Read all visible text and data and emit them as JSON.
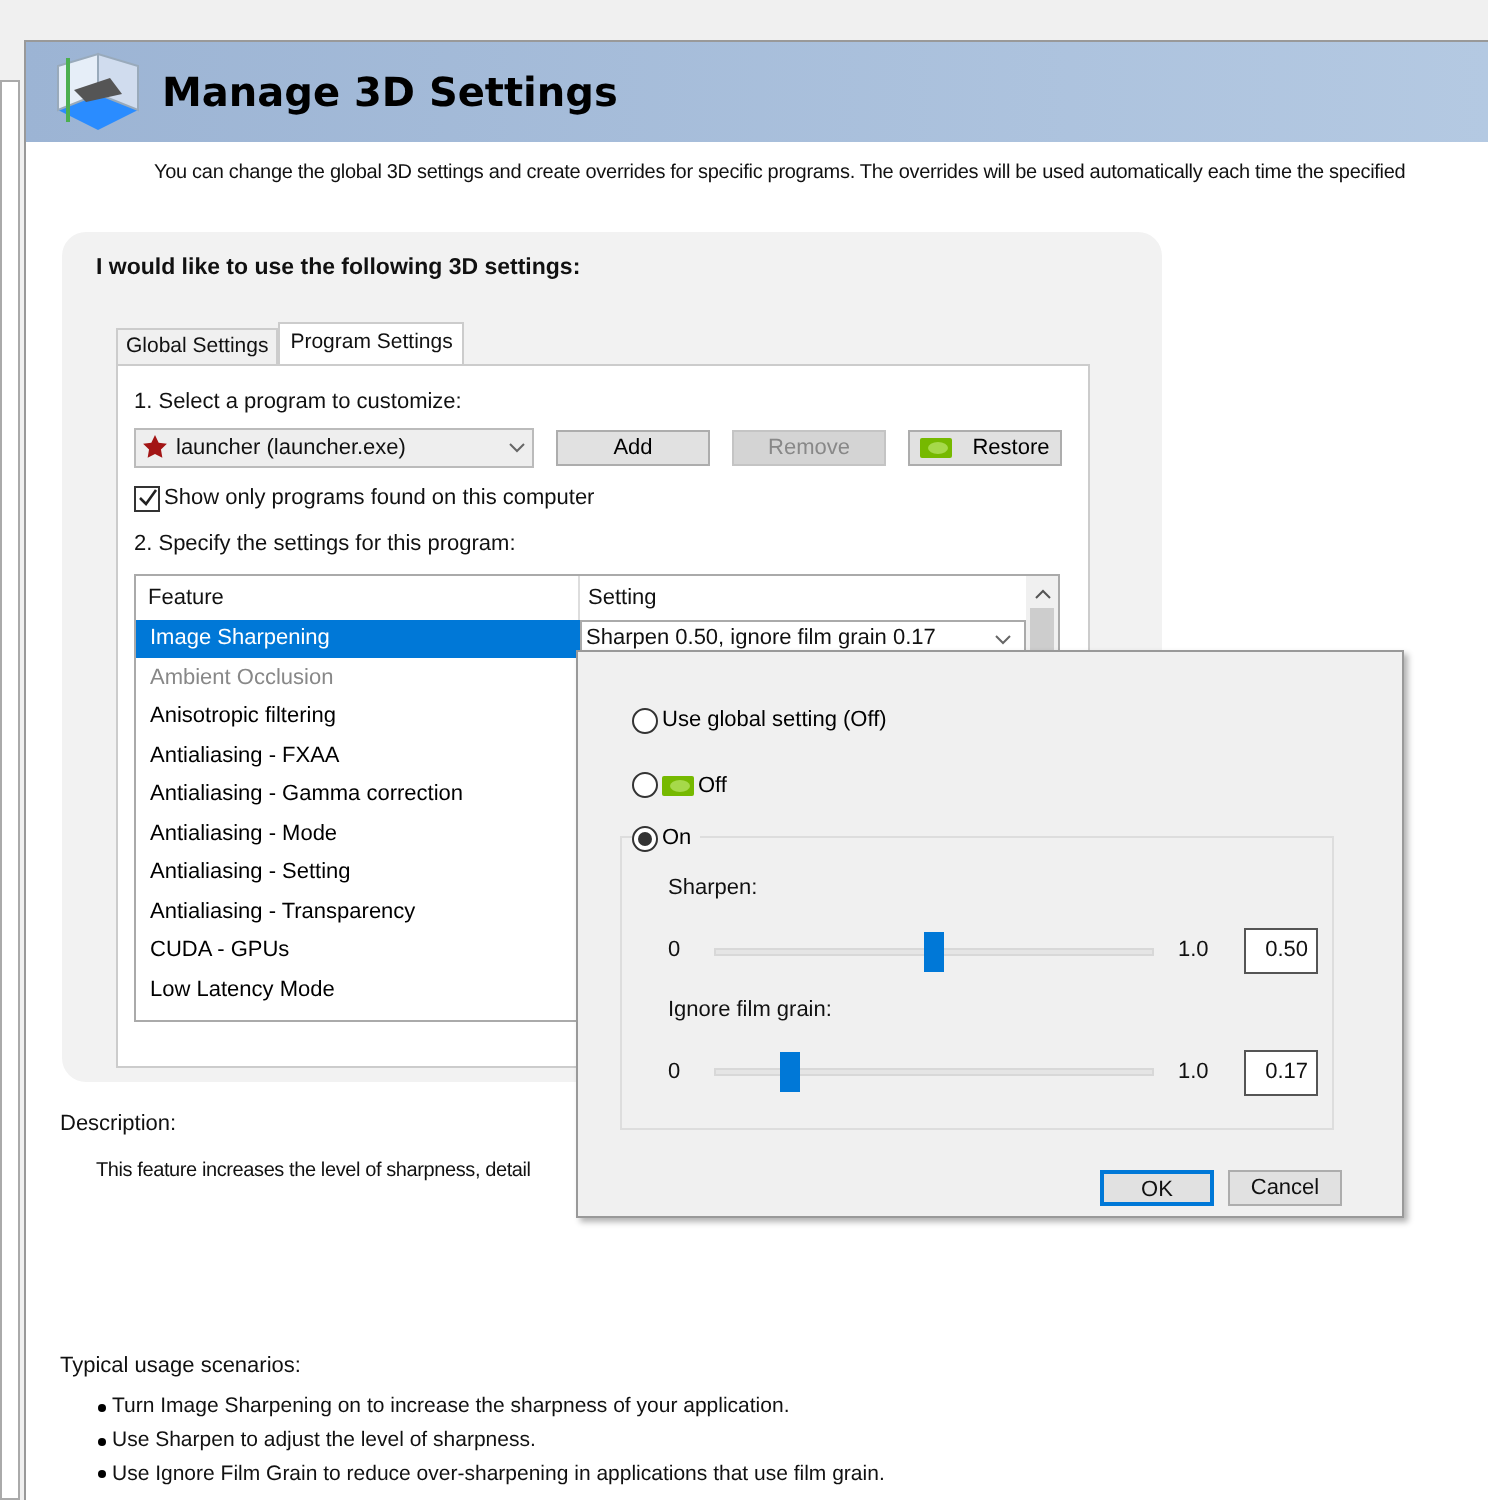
{
  "header": {
    "title": "Manage 3D Settings",
    "intro": "You can change the global 3D settings and create overrides for specific programs. The overrides will be used automatically each time the specified"
  },
  "panel": {
    "title": "I would like to use the following 3D settings:",
    "tabs": [
      {
        "label": "Global Settings",
        "selected": false
      },
      {
        "label": "Program Settings",
        "selected": true
      }
    ],
    "step1": "1. Select a program to customize:",
    "program": "launcher (launcher.exe)",
    "buttons": [
      {
        "label": "Add",
        "disabled": false,
        "kind": "plain"
      },
      {
        "label": "Remove",
        "disabled": true,
        "kind": "plain"
      },
      {
        "label": "Restore",
        "disabled": false,
        "kind": "logo"
      }
    ],
    "show_only": {
      "label": "Show only programs found on this computer",
      "checked": true
    },
    "step2": "2. Specify the settings for this program:",
    "table": {
      "columns": [
        "Feature",
        "Setting"
      ],
      "rows": [
        {
          "feature": "Image Sharpening",
          "setting": "Sharpen 0.50, ignore film grain 0.17",
          "selected": true,
          "disabled": false
        },
        {
          "feature": "Ambient Occlusion",
          "selected": false,
          "disabled": true
        },
        {
          "feature": "Anisotropic filtering",
          "selected": false,
          "disabled": false
        },
        {
          "feature": "Antialiasing - FXAA",
          "selected": false,
          "disabled": false
        },
        {
          "feature": "Antialiasing - Gamma correction",
          "selected": false,
          "disabled": false
        },
        {
          "feature": "Antialiasing - Mode",
          "selected": false,
          "disabled": false
        },
        {
          "feature": "Antialiasing - Setting",
          "selected": false,
          "disabled": false
        },
        {
          "feature": "Antialiasing - Transparency",
          "selected": false,
          "disabled": false
        },
        {
          "feature": "CUDA - GPUs",
          "selected": false,
          "disabled": false
        },
        {
          "feature": "Low Latency Mode",
          "selected": false,
          "disabled": false
        }
      ]
    }
  },
  "popup": {
    "options": [
      {
        "label": "Use global setting (Off)",
        "selected": false,
        "kind": "plain"
      },
      {
        "label": "Off",
        "selected": false,
        "kind": "logo"
      },
      {
        "label": "On",
        "selected": true,
        "kind": "group"
      }
    ],
    "sliders": [
      {
        "label": "Sharpen:",
        "min": "0",
        "max": "1.0",
        "value": "0.50",
        "level": 0.5
      },
      {
        "label": "Ignore film grain:",
        "min": "0",
        "max": "1.0",
        "value": "0.17",
        "level": 0.17
      }
    ],
    "buttons": [
      {
        "label": "OK",
        "default": true
      },
      {
        "label": "Cancel",
        "default": false
      }
    ]
  },
  "description": {
    "label": "Description:",
    "text": "This feature increases the level of sharpness, detail"
  },
  "usage": {
    "label": "Typical usage scenarios:",
    "items": [
      "Turn Image Sharpening on to increase the sharpness of your application.",
      "Use Sharpen to adjust the level of sharpness.",
      "Use Ignore Film Grain to reduce over-sharpening in applications that use film grain."
    ]
  }
}
